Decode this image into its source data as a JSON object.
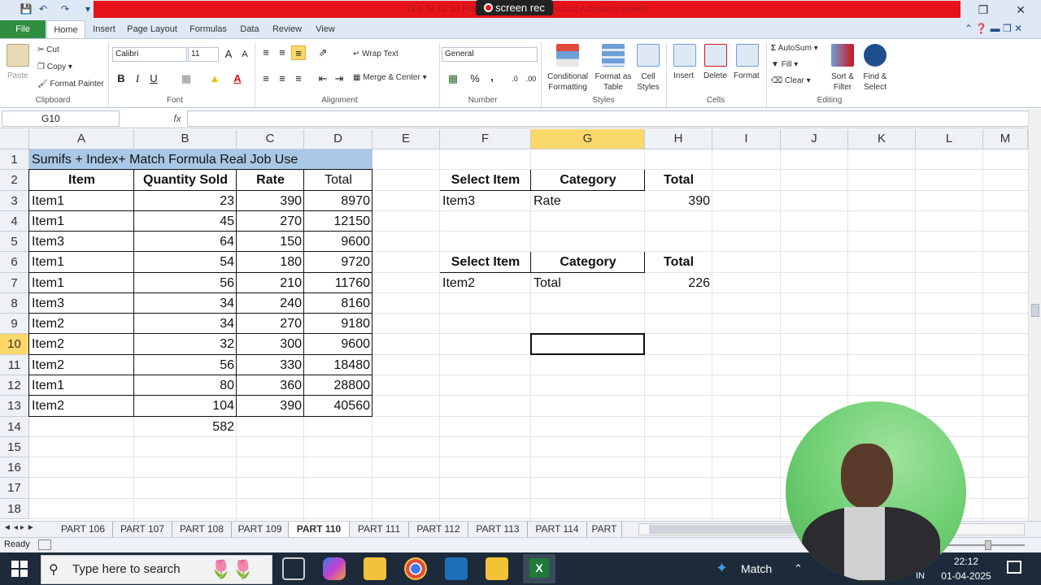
{
  "window": {
    "title": "12 1 Sr 12 10 Practice File - Excel (Product Activation Failed)",
    "recorder": "screen rec"
  },
  "tabs": [
    "File",
    "Home",
    "Insert",
    "Page Layout",
    "Formulas",
    "Data",
    "Review",
    "View"
  ],
  "ribbon": {
    "clipboard": {
      "paste": "Paste",
      "cut": "Cut",
      "copy": "Copy",
      "format_painter": "Format Painter",
      "label": "Clipboard"
    },
    "font": {
      "name": "Calibri",
      "size": "11",
      "bold": "B",
      "italic": "I",
      "underline": "U",
      "label": "Font"
    },
    "alignment": {
      "wrap": "Wrap Text",
      "merge": "Merge & Center",
      "label": "Alignment"
    },
    "number": {
      "format": "General",
      "label": "Number",
      "pct": "%",
      "comma": ","
    },
    "styles": {
      "conditional": "Conditional Formatting",
      "format_table": "Format as Table",
      "cell_styles": "Cell Styles",
      "label": "Styles"
    },
    "cells": {
      "insert": "Insert",
      "delete": "Delete",
      "format": "Format",
      "label": "Cells"
    },
    "editing": {
      "autosum": "AutoSum",
      "fill": "Fill",
      "clear": "Clear",
      "sort": "Sort & Filter",
      "find": "Find & Select",
      "label": "Editing"
    }
  },
  "formula_bar": {
    "name_box": "G10",
    "fx": "fx",
    "value": ""
  },
  "columns": [
    "A",
    "B",
    "C",
    "D",
    "E",
    "F",
    "G",
    "H",
    "I",
    "J",
    "K",
    "L",
    "M"
  ],
  "rows": [
    "1",
    "2",
    "3",
    "4",
    "5",
    "6",
    "7",
    "8",
    "9",
    "10",
    "11",
    "12",
    "13",
    "14",
    "15",
    "16",
    "17",
    "18"
  ],
  "cells": {
    "A1": "Sumifs + Index+ Match Formula Real Job Use",
    "A2": "Item",
    "B2": "Quantity Sold",
    "C2": "Rate",
    "D2": "Total",
    "data": [
      [
        "Item1",
        "23",
        "390",
        "8970"
      ],
      [
        "Item1",
        "45",
        "270",
        "12150"
      ],
      [
        "Item3",
        "64",
        "150",
        "9600"
      ],
      [
        "Item1",
        "54",
        "180",
        "9720"
      ],
      [
        "Item1",
        "56",
        "210",
        "11760"
      ],
      [
        "Item3",
        "34",
        "240",
        "8160"
      ],
      [
        "Item2",
        "34",
        "270",
        "9180"
      ],
      [
        "Item2",
        "32",
        "300",
        "9600"
      ],
      [
        "Item2",
        "56",
        "330",
        "18480"
      ],
      [
        "Item1",
        "80",
        "360",
        "28800"
      ],
      [
        "Item2",
        "104",
        "390",
        "40560"
      ]
    ],
    "B14": "582",
    "F2": "Select Item",
    "G2": "Category",
    "H2": "Total",
    "F3": "Item3",
    "G3": "Rate",
    "H3": "390",
    "F6": "Select Item",
    "G6": "Category",
    "H6": "Total",
    "F7": "Item2",
    "G7": "Total",
    "H7": "226"
  },
  "sheets": [
    "PART 106",
    "PART 107",
    "PART 108",
    "PART 109",
    "PART 110",
    "PART 111",
    "PART 112",
    "PART 113",
    "PART 114",
    "PART"
  ],
  "active_sheet": "PART 110",
  "status": "Ready",
  "taskbar": {
    "search": "Type here to search",
    "weather": "Match",
    "lang": "IN",
    "time": "22:12",
    "date": "01-04-2025"
  },
  "colors": {
    "title_red": "#e6141a",
    "file_green": "#2f8d3f",
    "selected_header": "#fbd86a",
    "a1_fill": "#a9c8e6"
  }
}
